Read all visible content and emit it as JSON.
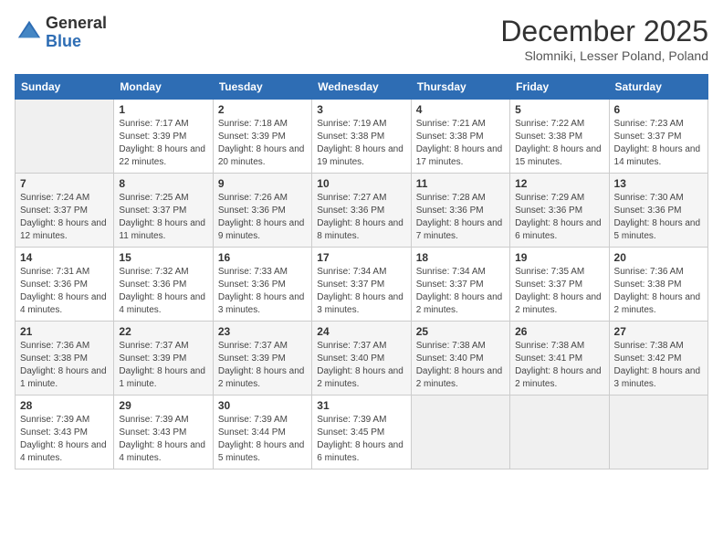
{
  "header": {
    "logo_line1": "General",
    "logo_line2": "Blue",
    "month": "December 2025",
    "location": "Slomniki, Lesser Poland, Poland"
  },
  "weekdays": [
    "Sunday",
    "Monday",
    "Tuesday",
    "Wednesday",
    "Thursday",
    "Friday",
    "Saturday"
  ],
  "weeks": [
    [
      {
        "num": "",
        "empty": true
      },
      {
        "num": "1",
        "sunrise": "7:17 AM",
        "sunset": "3:39 PM",
        "daylight": "8 hours and 22 minutes."
      },
      {
        "num": "2",
        "sunrise": "7:18 AM",
        "sunset": "3:39 PM",
        "daylight": "8 hours and 20 minutes."
      },
      {
        "num": "3",
        "sunrise": "7:19 AM",
        "sunset": "3:38 PM",
        "daylight": "8 hours and 19 minutes."
      },
      {
        "num": "4",
        "sunrise": "7:21 AM",
        "sunset": "3:38 PM",
        "daylight": "8 hours and 17 minutes."
      },
      {
        "num": "5",
        "sunrise": "7:22 AM",
        "sunset": "3:38 PM",
        "daylight": "8 hours and 15 minutes."
      },
      {
        "num": "6",
        "sunrise": "7:23 AM",
        "sunset": "3:37 PM",
        "daylight": "8 hours and 14 minutes."
      }
    ],
    [
      {
        "num": "7",
        "sunrise": "7:24 AM",
        "sunset": "3:37 PM",
        "daylight": "8 hours and 12 minutes."
      },
      {
        "num": "8",
        "sunrise": "7:25 AM",
        "sunset": "3:37 PM",
        "daylight": "8 hours and 11 minutes."
      },
      {
        "num": "9",
        "sunrise": "7:26 AM",
        "sunset": "3:36 PM",
        "daylight": "8 hours and 9 minutes."
      },
      {
        "num": "10",
        "sunrise": "7:27 AM",
        "sunset": "3:36 PM",
        "daylight": "8 hours and 8 minutes."
      },
      {
        "num": "11",
        "sunrise": "7:28 AM",
        "sunset": "3:36 PM",
        "daylight": "8 hours and 7 minutes."
      },
      {
        "num": "12",
        "sunrise": "7:29 AM",
        "sunset": "3:36 PM",
        "daylight": "8 hours and 6 minutes."
      },
      {
        "num": "13",
        "sunrise": "7:30 AM",
        "sunset": "3:36 PM",
        "daylight": "8 hours and 5 minutes."
      }
    ],
    [
      {
        "num": "14",
        "sunrise": "7:31 AM",
        "sunset": "3:36 PM",
        "daylight": "8 hours and 4 minutes."
      },
      {
        "num": "15",
        "sunrise": "7:32 AM",
        "sunset": "3:36 PM",
        "daylight": "8 hours and 4 minutes."
      },
      {
        "num": "16",
        "sunrise": "7:33 AM",
        "sunset": "3:36 PM",
        "daylight": "8 hours and 3 minutes."
      },
      {
        "num": "17",
        "sunrise": "7:34 AM",
        "sunset": "3:37 PM",
        "daylight": "8 hours and 3 minutes."
      },
      {
        "num": "18",
        "sunrise": "7:34 AM",
        "sunset": "3:37 PM",
        "daylight": "8 hours and 2 minutes."
      },
      {
        "num": "19",
        "sunrise": "7:35 AM",
        "sunset": "3:37 PM",
        "daylight": "8 hours and 2 minutes."
      },
      {
        "num": "20",
        "sunrise": "7:36 AM",
        "sunset": "3:38 PM",
        "daylight": "8 hours and 2 minutes."
      }
    ],
    [
      {
        "num": "21",
        "sunrise": "7:36 AM",
        "sunset": "3:38 PM",
        "daylight": "8 hours and 1 minute."
      },
      {
        "num": "22",
        "sunrise": "7:37 AM",
        "sunset": "3:39 PM",
        "daylight": "8 hours and 1 minute."
      },
      {
        "num": "23",
        "sunrise": "7:37 AM",
        "sunset": "3:39 PM",
        "daylight": "8 hours and 2 minutes."
      },
      {
        "num": "24",
        "sunrise": "7:37 AM",
        "sunset": "3:40 PM",
        "daylight": "8 hours and 2 minutes."
      },
      {
        "num": "25",
        "sunrise": "7:38 AM",
        "sunset": "3:40 PM",
        "daylight": "8 hours and 2 minutes."
      },
      {
        "num": "26",
        "sunrise": "7:38 AM",
        "sunset": "3:41 PM",
        "daylight": "8 hours and 2 minutes."
      },
      {
        "num": "27",
        "sunrise": "7:38 AM",
        "sunset": "3:42 PM",
        "daylight": "8 hours and 3 minutes."
      }
    ],
    [
      {
        "num": "28",
        "sunrise": "7:39 AM",
        "sunset": "3:43 PM",
        "daylight": "8 hours and 4 minutes."
      },
      {
        "num": "29",
        "sunrise": "7:39 AM",
        "sunset": "3:43 PM",
        "daylight": "8 hours and 4 minutes."
      },
      {
        "num": "30",
        "sunrise": "7:39 AM",
        "sunset": "3:44 PM",
        "daylight": "8 hours and 5 minutes."
      },
      {
        "num": "31",
        "sunrise": "7:39 AM",
        "sunset": "3:45 PM",
        "daylight": "8 hours and 6 minutes."
      },
      {
        "num": "",
        "empty": true
      },
      {
        "num": "",
        "empty": true
      },
      {
        "num": "",
        "empty": true
      }
    ]
  ],
  "labels": {
    "sunrise_prefix": "Sunrise: ",
    "sunset_prefix": "Sunset: ",
    "daylight_prefix": "Daylight: "
  }
}
